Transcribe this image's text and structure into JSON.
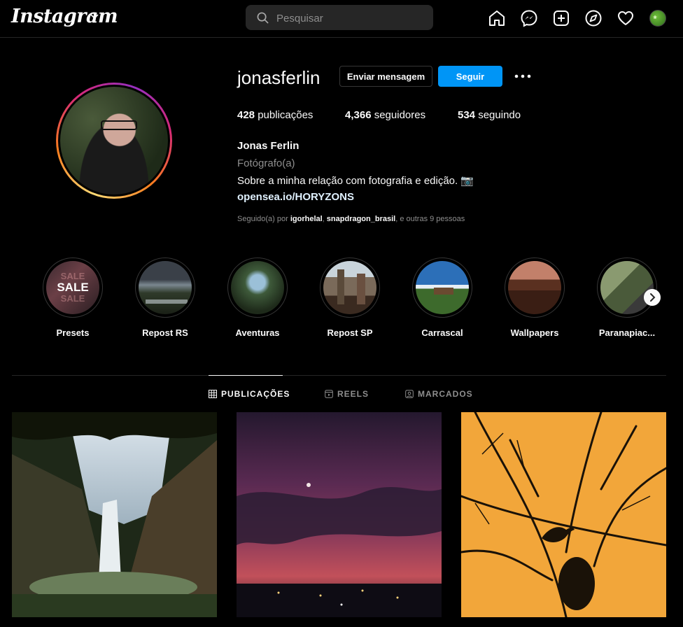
{
  "topbar": {
    "logo": "Instagram",
    "search_placeholder": "Pesquisar",
    "nav_icons": [
      "home-icon",
      "messenger-icon",
      "new-post-icon",
      "explore-icon",
      "activity-heart-icon",
      "profile-avatar"
    ],
    "accent": "#0095f6"
  },
  "profile": {
    "username": "jonasferlin",
    "message_button": "Enviar mensagem",
    "follow_button": "Seguir",
    "stats": {
      "posts_count": "428",
      "posts_label": "publicações",
      "followers_count": "4,366",
      "followers_label": "seguidores",
      "following_count": "534",
      "following_label": "seguindo"
    },
    "full_name": "Jonas Ferlin",
    "category": "Fotógrafo(a)",
    "bio": "Sobre a minha relação com fotografia e edição. 📷",
    "link": "opensea.io/HORYZONS",
    "followed_by": {
      "prefix": "Seguido(a) por ",
      "user1": "igorhelal",
      "sep": ", ",
      "user2": "snapdragon_brasil",
      "suffix": ", e outras 9 pessoas"
    }
  },
  "highlights": [
    {
      "label": "Presets"
    },
    {
      "label": "Repost RS"
    },
    {
      "label": "Aventuras"
    },
    {
      "label": "Repost SP"
    },
    {
      "label": "Carrascal"
    },
    {
      "label": "Wallpapers"
    },
    {
      "label": "Paranapiac..."
    }
  ],
  "highlight_sale_text": "SALE",
  "tabs": [
    {
      "label": "PUBLICAÇÕES",
      "icon": "grid-icon",
      "active": true
    },
    {
      "label": "REELS",
      "icon": "reels-icon",
      "active": false
    },
    {
      "label": "MARCADOS",
      "icon": "tagged-icon",
      "active": false
    }
  ],
  "posts": [
    {
      "subject": "waterfall"
    },
    {
      "subject": "purple-sky-city"
    },
    {
      "subject": "bird-silhouette"
    }
  ]
}
